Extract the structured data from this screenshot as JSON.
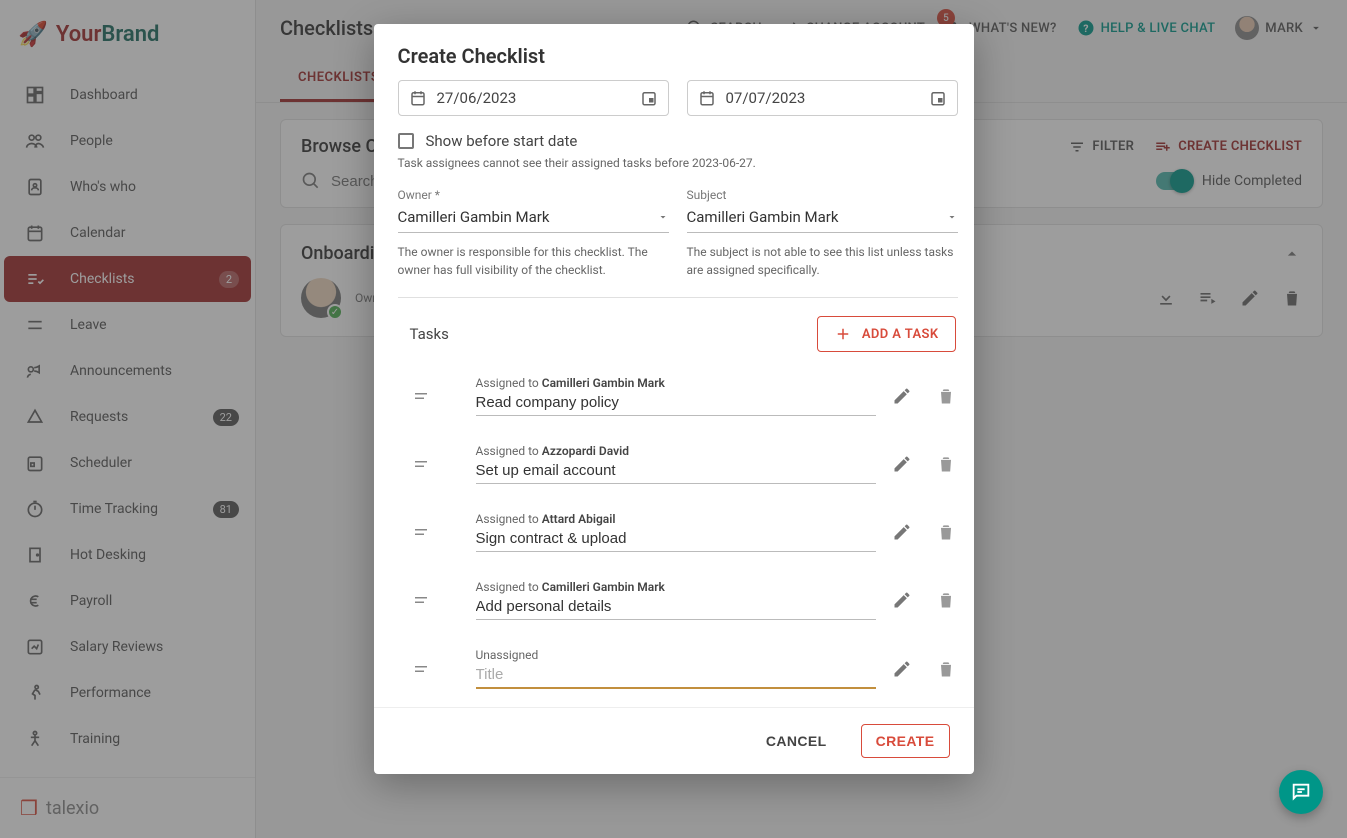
{
  "brand": {
    "your": "Your",
    "brand": "Brand"
  },
  "footer_brand": "talexio",
  "sidebar": {
    "items": [
      {
        "label": "Dashboard",
        "icon": "dashboard-icon"
      },
      {
        "label": "People",
        "icon": "people-icon"
      },
      {
        "label": "Who's who",
        "icon": "contacts-icon"
      },
      {
        "label": "Calendar",
        "icon": "calendar-icon"
      },
      {
        "label": "Checklists",
        "icon": "checklist-icon",
        "badge": "2",
        "active": true
      },
      {
        "label": "Leave",
        "icon": "leave-icon"
      },
      {
        "label": "Announcements",
        "icon": "announce-icon"
      },
      {
        "label": "Requests",
        "icon": "requests-icon",
        "badge": "22"
      },
      {
        "label": "Scheduler",
        "icon": "scheduler-icon"
      },
      {
        "label": "Time Tracking",
        "icon": "timer-icon",
        "badge": "81"
      },
      {
        "label": "Hot Desking",
        "icon": "door-icon"
      },
      {
        "label": "Payroll",
        "icon": "euro-icon"
      },
      {
        "label": "Salary Reviews",
        "icon": "review-icon"
      },
      {
        "label": "Performance",
        "icon": "run-icon"
      },
      {
        "label": "Training",
        "icon": "body-icon"
      }
    ]
  },
  "topbar": {
    "title": "Checklists",
    "search": "SEARCH",
    "change_account": "CHANGE ACCOUNT",
    "whats_new": "WHAT'S NEW?",
    "whats_new_count": "5",
    "help": "HELP & LIVE CHAT",
    "user": "MARK"
  },
  "tabs": [
    "CHECKLISTS"
  ],
  "browse": {
    "title": "Browse Checklists",
    "filter": "FILTER",
    "create": "CREATE CHECKLIST",
    "search_placeholder": "Search…",
    "hide_completed": "Hide Completed"
  },
  "checklist_item": {
    "title": "Onboarding",
    "owner_label": "Owner"
  },
  "modal": {
    "title": "Create Checklist",
    "start_date": "27/06/2023",
    "end_date": "07/07/2023",
    "show_before": "Show before start date",
    "note_text": "Task assignees cannot see their assigned tasks before 2023-06-27.",
    "owner_label": "Owner *",
    "owner_value": "Camilleri Gambin Mark",
    "owner_help": "The owner is responsible for this checklist. The owner has full visibility of the checklist.",
    "subject_label": "Subject",
    "subject_value": "Camilleri Gambin Mark",
    "subject_help": "The subject is not able to see this list unless tasks are assigned specifically.",
    "tasks_heading": "Tasks",
    "add_task": "ADD A TASK",
    "assigned_prefix": "Assigned to ",
    "unassigned": "Unassigned",
    "title_placeholder": "Title",
    "cancel": "CANCEL",
    "create": "CREATE",
    "tasks": [
      {
        "assignee": "Camilleri Gambin Mark",
        "title": "Read company policy"
      },
      {
        "assignee": "Azzopardi David",
        "title": "Set up email account"
      },
      {
        "assignee": "Attard Abigail",
        "title": "Sign contract & upload"
      },
      {
        "assignee": "Camilleri Gambin Mark",
        "title": "Add personal details"
      },
      {
        "assignee": null,
        "title": ""
      }
    ]
  }
}
